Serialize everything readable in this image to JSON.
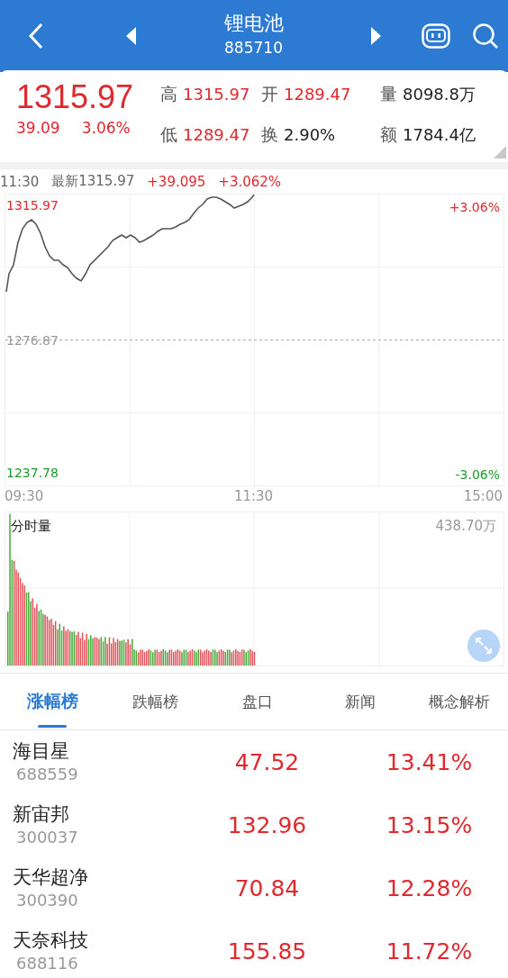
{
  "header": {
    "title": "锂电池",
    "code": "885710"
  },
  "quote": {
    "price": "1315.97",
    "change": "39.09",
    "change_pct": "3.06%",
    "stats": [
      {
        "label": "高",
        "value": "1315.97",
        "color": "#e0282e"
      },
      {
        "label": "开",
        "value": "1289.47",
        "color": "#e0282e"
      },
      {
        "label": "量",
        "value": "8098.8万",
        "color": "#222222"
      },
      {
        "label": "低",
        "value": "1289.47",
        "color": "#e0282e"
      },
      {
        "label": "换",
        "value": "2.90%",
        "color": "#222222"
      },
      {
        "label": "额",
        "value": "1784.4亿",
        "color": "#222222"
      }
    ]
  },
  "intraday": {
    "time": "11:30",
    "latest": "最新1315.97",
    "change": "+39.095",
    "change_pct": "+3.062%",
    "pct_labels": [
      "+3.06%",
      "-3.06%"
    ],
    "price_labels": [
      "1315.97",
      "1276.87",
      "1237.78"
    ],
    "time_labels": [
      "09:30",
      "11:30",
      "15:00"
    ]
  },
  "volume": {
    "title": "分时量",
    "max": "438.70万"
  },
  "tabs": [
    {
      "label": "涨幅榜",
      "selected": true
    },
    {
      "label": "跌幅榜",
      "selected": false
    },
    {
      "label": "盘口",
      "selected": false
    },
    {
      "label": "新闻",
      "selected": false
    },
    {
      "label": "概念解析",
      "selected": false
    }
  ],
  "rows": [
    {
      "name": "海目星",
      "code": "688559",
      "price": "47.52",
      "change_pct": "13.41%"
    },
    {
      "name": "新宙邦",
      "code": "300037",
      "price": "132.96",
      "change_pct": "13.15%"
    },
    {
      "name": "天华超净",
      "code": "300390",
      "price": "70.84",
      "change_pct": "12.28%"
    },
    {
      "name": "天奈科技",
      "code": "688116",
      "price": "155.85",
      "change_pct": "11.72%"
    }
  ]
}
